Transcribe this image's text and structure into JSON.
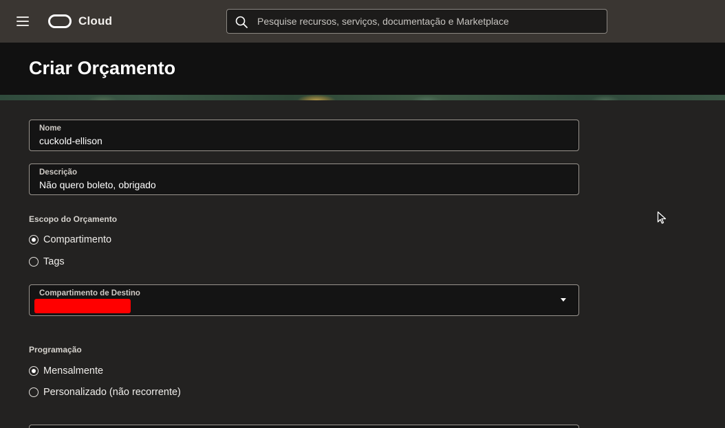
{
  "topbar": {
    "brand": "Cloud",
    "search_placeholder": "Pesquise recursos, serviços, documentação e Marketplace"
  },
  "page": {
    "title": "Criar Orçamento"
  },
  "form": {
    "name": {
      "label": "Nome",
      "value": "cuckold-ellison"
    },
    "description": {
      "label": "Descrição",
      "value": "Não quero boleto, obrigado"
    },
    "scope": {
      "label": "Escopo do Orçamento",
      "options": [
        {
          "label": "Compartimento",
          "selected": true
        },
        {
          "label": "Tags",
          "selected": false
        }
      ]
    },
    "target_compartment": {
      "label": "Compartimento de Destino",
      "value_redacted": true
    },
    "schedule": {
      "label": "Programação",
      "options": [
        {
          "label": "Mensalmente",
          "selected": true
        },
        {
          "label": "Personalizado (não recorrente)",
          "selected": false
        }
      ]
    }
  },
  "colors": {
    "topbar": "#3a3632",
    "header": "#111111",
    "content": "#232221",
    "redaction": "#ff0000"
  }
}
